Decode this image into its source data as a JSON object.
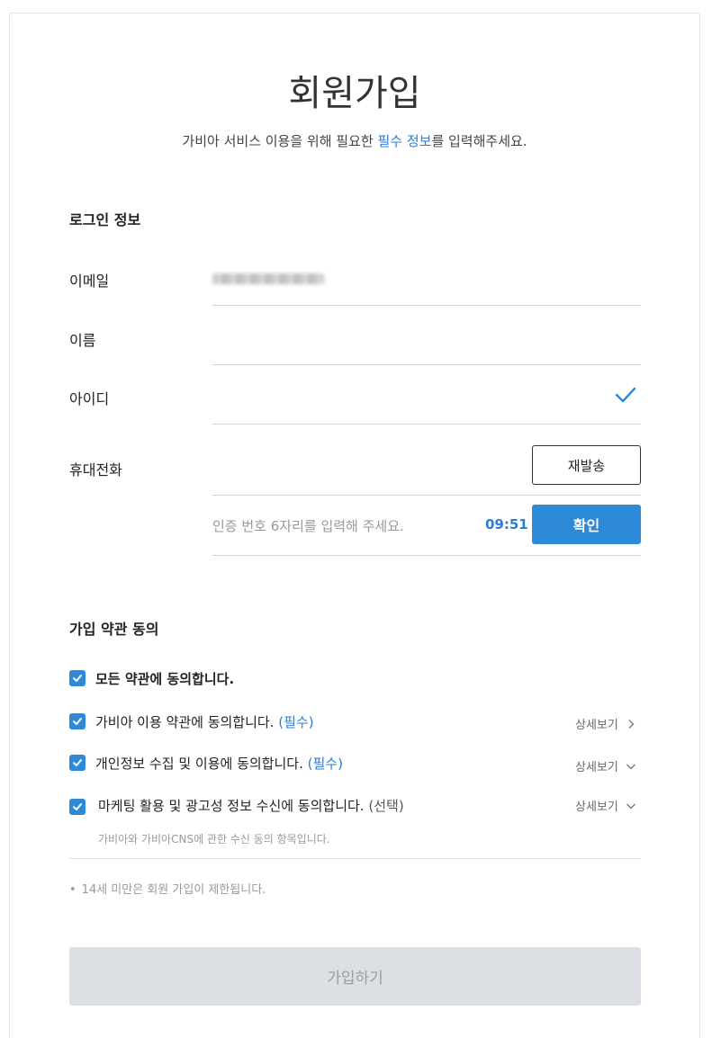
{
  "header": {
    "title": "회원가입",
    "subtitle_prefix": "가비아 서비스 이용을 위해 필요한 ",
    "subtitle_highlight": "필수 정보",
    "subtitle_suffix": "를 입력해주세요."
  },
  "login_section": {
    "title": "로그인 정보",
    "fields": [
      {
        "label": "이메일",
        "value": "(masked email)"
      },
      {
        "label": "이름",
        "value": ""
      },
      {
        "label": "아이디",
        "value": "",
        "status_icon": "checkmark-icon"
      },
      {
        "label": "휴대전화",
        "value": ""
      }
    ],
    "phone": {
      "resend_label": "재발송",
      "code_placeholder": "인증 번호 6자리를 입력해 주세요.",
      "timer": "09:51",
      "confirm_label": "확인"
    }
  },
  "terms_section": {
    "title": "가입 약관 동의",
    "all": {
      "label": "모든 약관에 동의합니다.",
      "checked": true
    },
    "items": [
      {
        "label": "가비아 이용 약관에 동의합니다.",
        "tag": "(필수)",
        "detail": "상세보기",
        "detail_icon": "chevron-right-icon",
        "checked": true
      },
      {
        "label": "개인정보 수집 및 이용에 동의합니다.",
        "tag": "(필수)",
        "detail": "상세보기",
        "detail_icon": "chevron-down-icon",
        "checked": true
      },
      {
        "label": "마케팅 활용 및 광고성 정보 수신에 동의합니다.",
        "tag": "(선택)",
        "detail": "상세보기",
        "detail_icon": "chevron-down-icon",
        "checked": true
      }
    ],
    "marketing_note": "가비아와 가비아CNS에 관한 수신 동의 항목입니다."
  },
  "notice": {
    "bullet": "•",
    "text": "14세 미만은 회원 가입이 제한됩니다."
  },
  "submit": {
    "label": "가입하기"
  },
  "colors": {
    "accent": "#2d8ad8",
    "link": "#2b7cd3",
    "disabled_bg": "#dcdfe3"
  }
}
